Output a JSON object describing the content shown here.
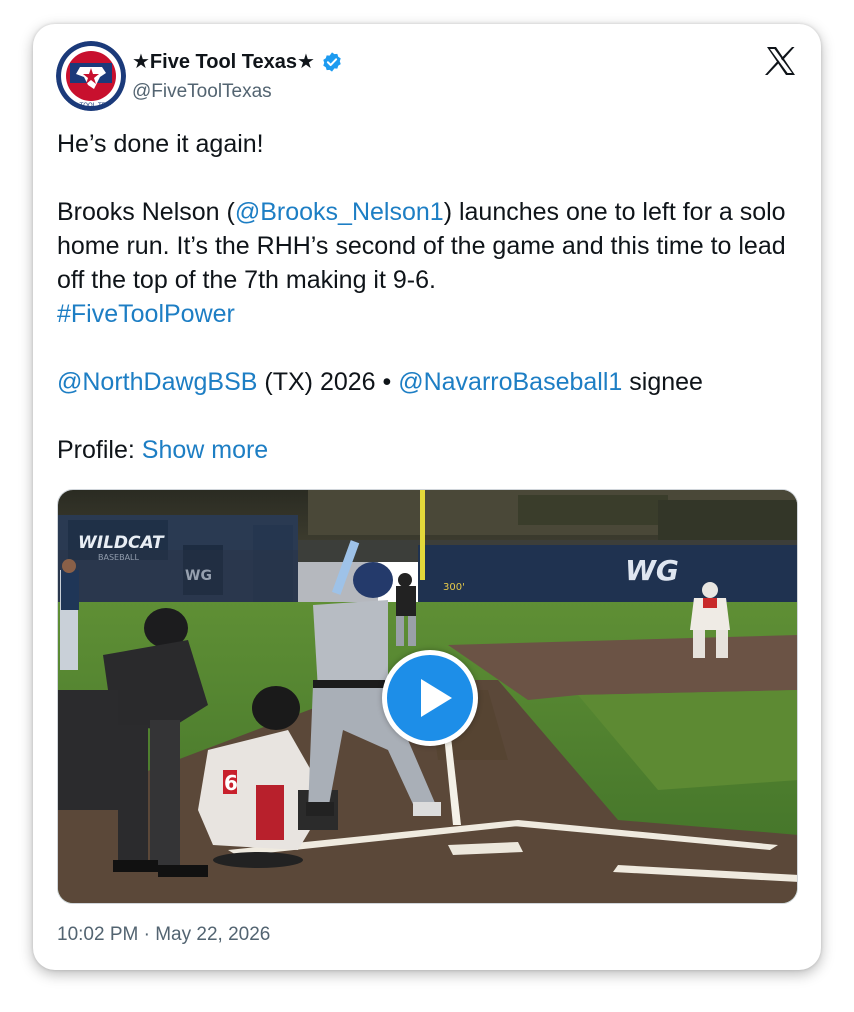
{
  "author": {
    "display_name": "★Five Tool Texas★",
    "handle": "@FiveToolTexas",
    "verified": true,
    "avatar_icon": "five-tool-texas-logo",
    "avatar_logo_text": "FIVE TOOL TEXAS"
  },
  "tweet": {
    "line1": "He’s done it again!",
    "p2_pre": "Brooks Nelson (",
    "p2_mention": "@Brooks_Nelson1",
    "p2_post": ") launches one to left for a solo home run. It’s the RHH’s second of the game and this time to lead off the top of the 7th making it 9-6.",
    "hashtag": "#FiveToolPower",
    "p3_mention1": "@NorthDawgBSB",
    "p3_mid": " (TX) 2026 • ",
    "p3_mention2": "@NavarroBaseball1",
    "p3_post": " signee",
    "profile_label": "Profile: ",
    "show_more": "Show more"
  },
  "media": {
    "type": "video",
    "play_icon": "play-icon",
    "stadium_sign": "WILDCAT",
    "stadium_sign_sub": "BASEBALL",
    "outfield_logo": "WG",
    "dugout_logo": "WG",
    "distance_marker": "300'",
    "jersey_number": "6"
  },
  "timestamp": "10:02 PM · May 22, 2026",
  "colors": {
    "link": "#1d7ec4",
    "verified": "#1d9bf0",
    "play": "#1d8ee8",
    "text": "#0f1419",
    "muted": "#536471"
  }
}
